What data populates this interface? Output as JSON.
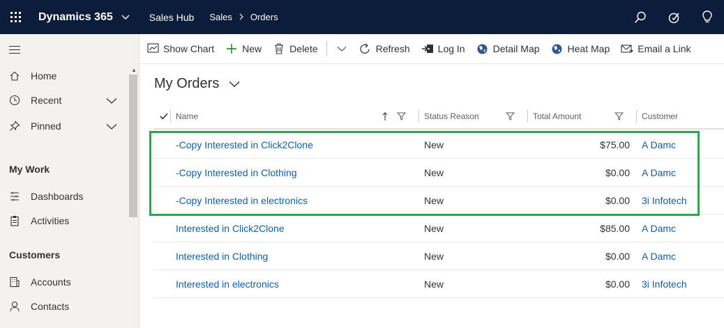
{
  "topbar": {
    "app_title": "Dynamics 365",
    "app_name": "Sales Hub",
    "breadcrumb": [
      "Sales",
      "Orders"
    ]
  },
  "sidebar": {
    "items": [
      {
        "label": "Home",
        "icon": "home-icon"
      },
      {
        "label": "Recent",
        "icon": "clock-icon"
      },
      {
        "label": "Pinned",
        "icon": "pin-icon"
      }
    ],
    "groups": [
      {
        "title": "My Work",
        "items": [
          {
            "label": "Dashboards",
            "icon": "dashboard-icon"
          },
          {
            "label": "Activities",
            "icon": "clipboard-icon"
          }
        ]
      },
      {
        "title": "Customers",
        "items": [
          {
            "label": "Accounts",
            "icon": "building-icon"
          },
          {
            "label": "Contacts",
            "icon": "person-icon"
          }
        ]
      }
    ]
  },
  "commands": [
    {
      "label": "Show Chart",
      "icon": "chart-icon"
    },
    {
      "label": "New",
      "icon": "plus-icon"
    },
    {
      "label": "Delete",
      "icon": "trash-icon"
    },
    {
      "label": "Refresh",
      "icon": "refresh-icon"
    },
    {
      "label": "Log In",
      "icon": "login-icon"
    },
    {
      "label": "Detail Map",
      "icon": "globe-icon"
    },
    {
      "label": "Heat Map",
      "icon": "globe-icon"
    },
    {
      "label": "Email a Link",
      "icon": "email-icon"
    }
  ],
  "view": {
    "title": "My Orders",
    "columns": [
      "Name",
      "Status Reason",
      "Total Amount",
      "Customer"
    ],
    "rows": [
      {
        "name": "-Copy Interested in Click2Clone",
        "status": "New",
        "amount": "$75.00",
        "customer": "A Damc"
      },
      {
        "name": "-Copy Interested in Clothing",
        "status": "New",
        "amount": "$0.00",
        "customer": "A Damc"
      },
      {
        "name": "-Copy Interested in electronics",
        "status": "New",
        "amount": "$0.00",
        "customer": "3i Infotech"
      },
      {
        "name": "Interested in Click2Clone",
        "status": "New",
        "amount": "$85.00",
        "customer": "A Damc"
      },
      {
        "name": "Interested in Clothing",
        "status": "New",
        "amount": "$0.00",
        "customer": "A Damc"
      },
      {
        "name": "Interested in electronics",
        "status": "New",
        "amount": "$0.00",
        "customer": "3i Infotech"
      }
    ]
  },
  "colors": {
    "topbar": "#0b1d3a",
    "link": "#115ea3",
    "highlight": "#2ea44f"
  }
}
